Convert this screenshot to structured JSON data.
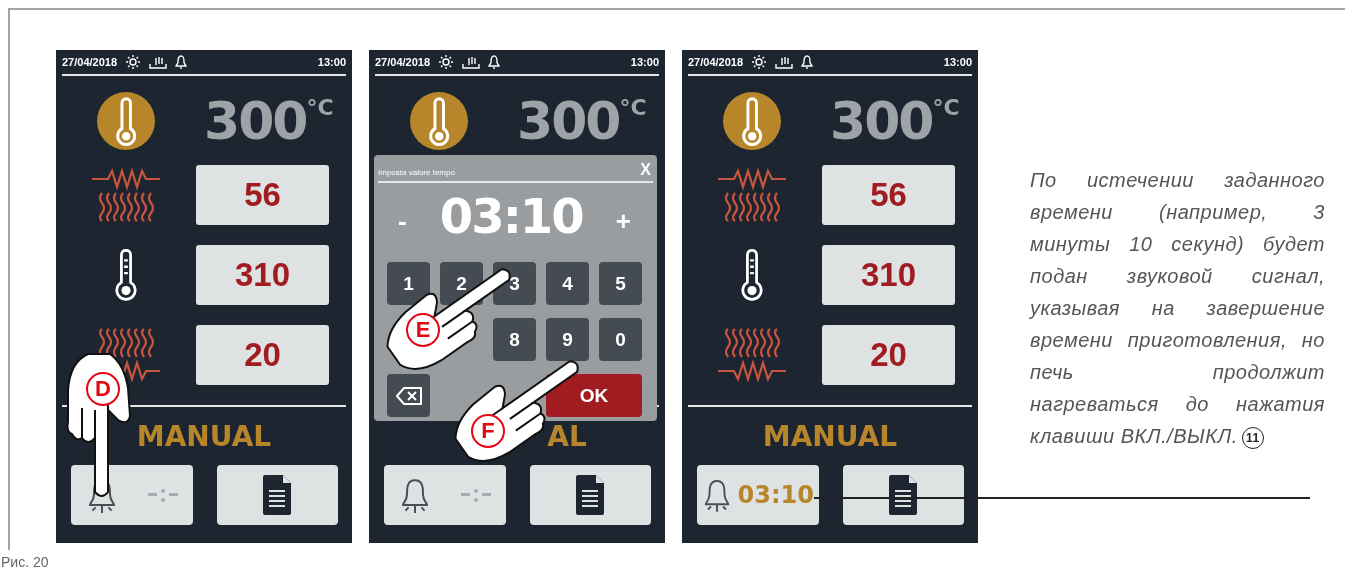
{
  "screens": [
    {
      "status": {
        "date": "27/04/2018",
        "time": "13:00"
      },
      "temperature": {
        "value": "300",
        "unit": "°C"
      },
      "readings": [
        {
          "kind": "heater_top",
          "value": "56"
        },
        {
          "kind": "probe",
          "value": "310"
        },
        {
          "kind": "heater_bottom",
          "value": "20"
        }
      ],
      "mode": "MANUAL",
      "pointers": [
        {
          "label": "D"
        }
      ]
    },
    {
      "status": {
        "date": "27/04/2018",
        "time": "13:00"
      },
      "temperature": {
        "value": "300",
        "unit": "°C"
      },
      "mode": "AL",
      "dialog": {
        "title": "Imposta valore tempo",
        "close": "X",
        "minus": "-",
        "value": "03:10",
        "plus": "+",
        "keys": [
          "1",
          "2",
          "3",
          "4",
          "5",
          "8",
          "9",
          "0"
        ],
        "ok": "OK"
      },
      "pointers": [
        {
          "label": "E"
        },
        {
          "label": "F"
        }
      ]
    },
    {
      "status": {
        "date": "27/04/2018",
        "time": "13:00"
      },
      "temperature": {
        "value": "300",
        "unit": "°C"
      },
      "readings": [
        {
          "kind": "heater_top",
          "value": "56"
        },
        {
          "kind": "probe",
          "value": "310"
        },
        {
          "kind": "heater_bottom",
          "value": "20"
        }
      ],
      "mode": "MANUAL",
      "timer": "03:10"
    }
  ],
  "description": "По истечении заданного времени (например, 3 минуты 10 секунд) будет подан звуковой сигнал, указывая на завершение времени приготовления, но печь продолжит нагреваться до нажатия клавиши ВКЛ./ВЫКЛ.",
  "callout": "11",
  "caption": "Рис. 20"
}
